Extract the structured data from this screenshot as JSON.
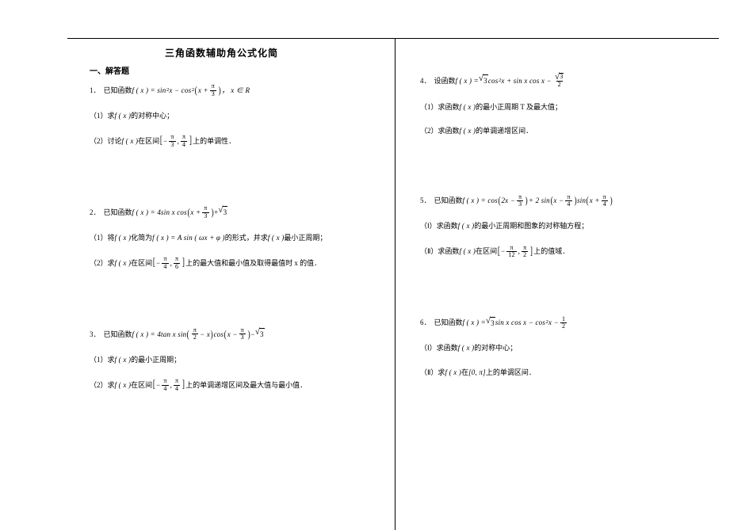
{
  "title": "三角函数辅助角公式化简",
  "section": "一、解答题",
  "left": {
    "q1": {
      "num": "1．",
      "lead": "已知函数",
      "fx_open": "f ( x ) = sin",
      "sq1": "2",
      "fx_mid1": "x − cos",
      "sq2": "2",
      "par_open": "(",
      "inner1": "x + ",
      "frac1_n": "π",
      "frac1_d": "3",
      "par_close": ")",
      "tail": "，   x ∈ R",
      "s1_label": "（1）求",
      "s1_fx": "f ( x )",
      "s1_rest": "的对称中心；",
      "s2_label": "（2）讨论",
      "s2_fx": "f ( x )",
      "s2_mid": "在区间",
      "s2_br_l": "[",
      "s2_neg": "−",
      "s2_f1n": "π",
      "s2_f1d": "3",
      "s2_comma": " , ",
      "s2_f2n": "π",
      "s2_f2d": "4",
      "s2_br_r": "]",
      "s2_rest": "上的单调性．"
    },
    "q2": {
      "num": "2．",
      "lead": "已知函数",
      "fx_open": "f ( x ) = 4sin x cos",
      "par_open": "(",
      "inner1": "x + ",
      "frac1_n": "π",
      "frac1_d": "3",
      "par_close": ")",
      "plus": " + ",
      "rad": "3",
      "s1_label": "（1）将",
      "s1_fx1": "f ( x )",
      "s1_mid1": "化简为",
      "s1_fx2": "f ( x ) = A sin ( ωx + φ )",
      "s1_mid2": "的形式，并求",
      "s1_fx3": "f ( x )",
      "s1_rest": "最小正周期；",
      "s2_label": "（2）求",
      "s2_fx": "f ( x )",
      "s2_mid": "在区间",
      "s2_br_l": "[",
      "s2_neg": "−",
      "s2_f1n": "π",
      "s2_f1d": "4",
      "s2_comma": " , ",
      "s2_f2n": "π",
      "s2_f2d": "6",
      "s2_br_r": "]",
      "s2_rest": "上的最大值和最小值及取得最值时 x 的值．"
    },
    "q3": {
      "num": "3．",
      "lead": "已知函数",
      "fx_open": "f ( x ) = 4tan x sin",
      "p1_l": "(",
      "f1n": "π",
      "f1d": "2",
      "p1_mid": " − x",
      "p1_r": ")",
      "mid": " cos",
      "p2_l": "(",
      "p2_lead": "x − ",
      "f2n": "π",
      "f2d": "3",
      "p2_r": ")",
      "minus": " − ",
      "rad": "3",
      "s1_label": "（1）求",
      "s1_fx": "f ( x )",
      "s1_rest": "的最小正周期；",
      "s2_label": "（2）求",
      "s2_fx": "f ( x )",
      "s2_mid": "在区间",
      "s2_br_l": "[",
      "s2_neg": "−",
      "s2_f1n": "π",
      "s2_f1d": "4",
      "s2_comma": " , ",
      "s2_f2n": "π",
      "s2_f2d": "4",
      "s2_br_r": "]",
      "s2_rest": "上的单调递增区间及最大值与最小值．"
    }
  },
  "right": {
    "q4": {
      "num": "4．",
      "lead": "设函数",
      "fx_open": "f ( x ) = ",
      "rad1": "3",
      "mid1": " cos",
      "sq1": "2",
      "mid2": "x + sin x cos x − ",
      "f_rad_n": "3",
      "f_rad_d": "2",
      "s1_label": "（1）求函数",
      "s1_fx": "f ( x )",
      "s1_rest": "的最小正周期 T 及最大值；",
      "s2_label": "（2）求函数",
      "s2_fx": "f ( x )",
      "s2_rest": "的单调递增区间．"
    },
    "q5": {
      "num": "5．",
      "lead": "已知函数",
      "fx_open": "f ( x ) = cos",
      "p1_l": "(",
      "p1_lead": "2x − ",
      "f1n": "π",
      "f1d": "3",
      "p1_r": ")",
      "plus": " + 2 sin",
      "p2_l": "(",
      "p2_lead": "x − ",
      "f2n": "π",
      "f2d": "4",
      "p2_r": ")",
      "mid": " sin",
      "p3_l": "(",
      "p3_lead": "x + ",
      "f3n": "π",
      "f3d": "4",
      "p3_r": ")",
      "s1_label": "（Ⅰ）求函数",
      "s1_fx": "f ( x )",
      "s1_rest": "的最小正周期和图象的对称轴方程；",
      "s2_label": "（Ⅱ）求函数",
      "s2_fx": "f ( x )",
      "s2_mid": "在区间",
      "s2_br_l": "[",
      "s2_neg": "−",
      "s2_f1n": "π",
      "s2_f1d": "12",
      "s2_comma": " , ",
      "s2_f2n": "π",
      "s2_f2d": "2",
      "s2_br_r": "]",
      "s2_rest": "上的值域．"
    },
    "q6": {
      "num": "6．",
      "lead": "已知函数",
      "fx_open": "f ( x ) = ",
      "rad1": "3",
      "mid1": " sin x cos x − cos",
      "sq1": "2",
      "mid2": "x − ",
      "f_n": "1",
      "f_d": "2",
      "s1_label": "（Ⅰ）求函数",
      "s1_fx": "f ( x )",
      "s1_rest": "的对称中心；",
      "s2_label": "（Ⅱ）求",
      "s2_fx": "f ( x )",
      "s2_mid": "在",
      "s2_interval": "[0, π]",
      "s2_rest": "上的单调区间．"
    }
  }
}
